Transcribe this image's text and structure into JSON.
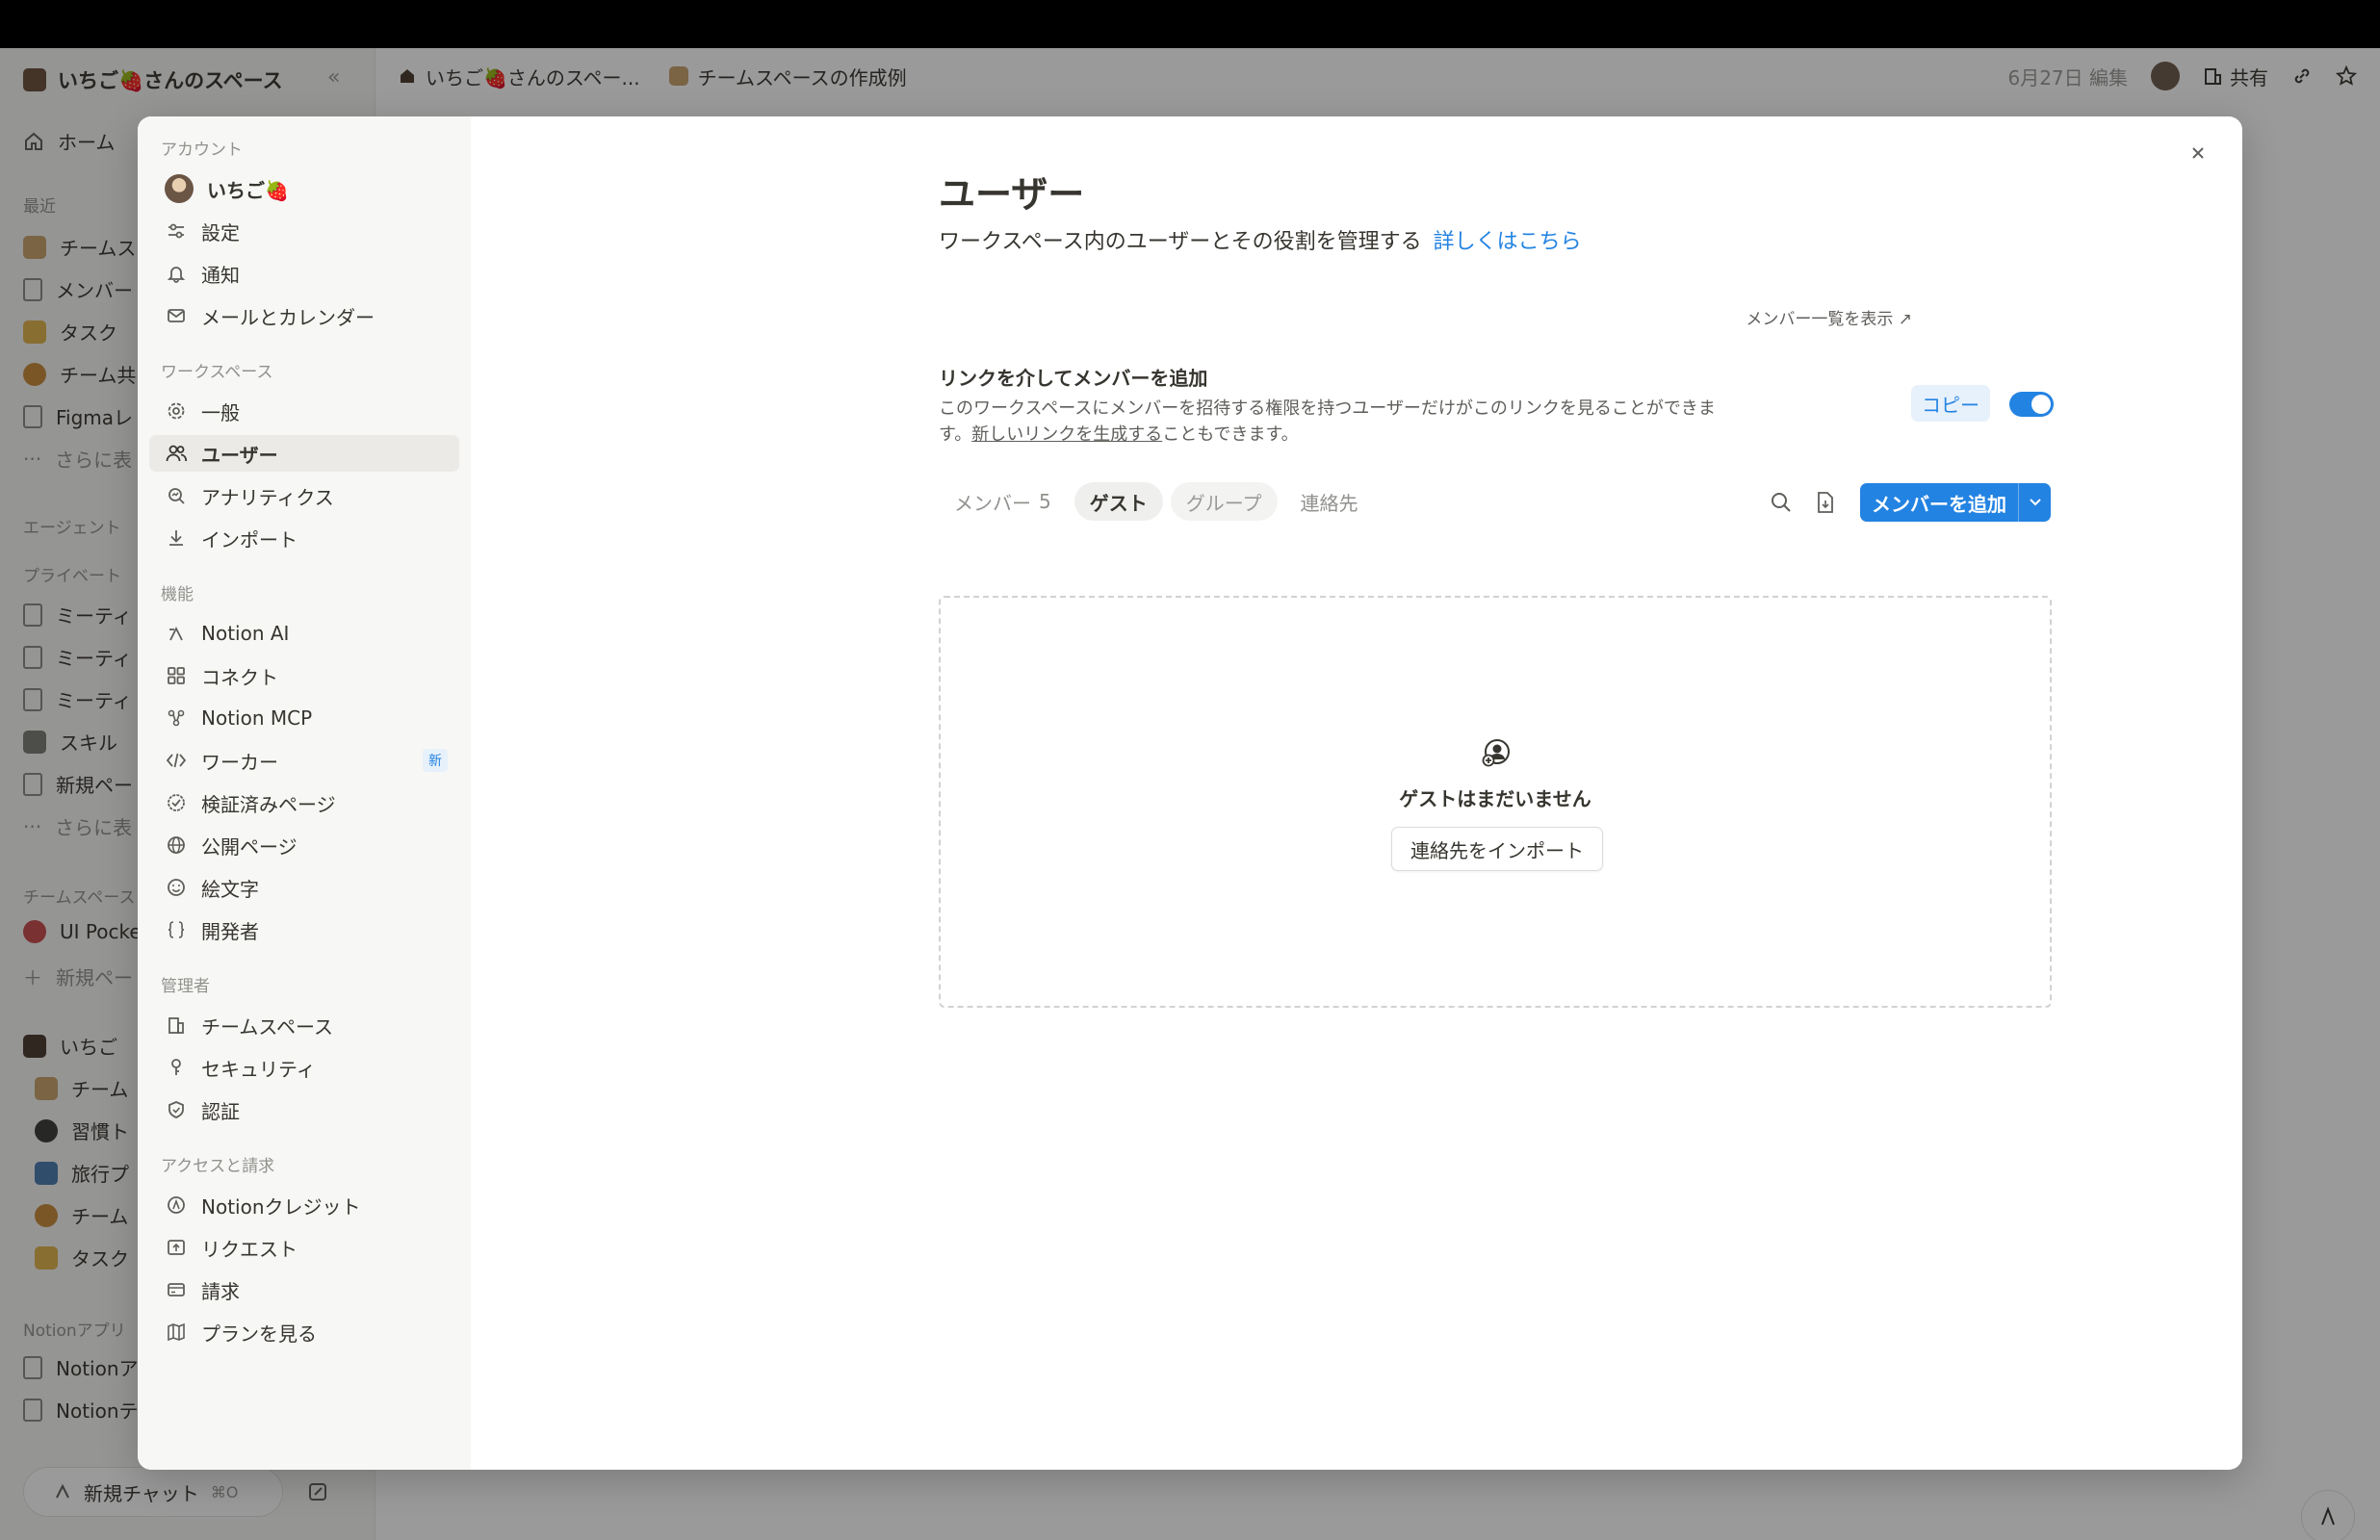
{
  "app": {
    "workspace_name": "いちご🍓さんのスペース",
    "breadcrumbs": [
      "いちご🍓さんのスペー...",
      "チームスペースの作成例"
    ],
    "edited": "6月27日 編集",
    "share_label": "共有",
    "collapse_glyph": "«"
  },
  "bg_sidebar": {
    "items": [
      {
        "label": "ホーム"
      },
      {
        "label": "チームス"
      },
      {
        "label": "メンバー"
      },
      {
        "label": "タスク"
      },
      {
        "label": "チーム共"
      },
      {
        "label": "Figmaレ"
      },
      {
        "label": "さらに表"
      },
      {
        "label": "ミーティ"
      },
      {
        "label": "ミーティ"
      },
      {
        "label": "ミーティ"
      },
      {
        "label": "スキル"
      },
      {
        "label": "新規ペー"
      },
      {
        "label": "さらに表"
      },
      {
        "label": "UI Pocke"
      },
      {
        "label": "新規ペー"
      },
      {
        "label": "いちご"
      },
      {
        "label": "チーム"
      },
      {
        "label": "習慣ト"
      },
      {
        "label": "旅行プ"
      },
      {
        "label": "チーム"
      },
      {
        "label": "タスク"
      },
      {
        "label": "Notionア"
      },
      {
        "label": "Notionテ"
      }
    ],
    "sections": [
      "最近",
      "エージェント",
      "プライベート",
      "チームスペース",
      "Notionアプリ"
    ],
    "new_chat": "新規チャット",
    "new_chat_kbd": "⌘O"
  },
  "settings_nav": {
    "account_section": "アカウント",
    "account_items": [
      "いちご🍓",
      "設定",
      "通知",
      "メールとカレンダー"
    ],
    "workspace_section": "ワークスペース",
    "workspace_items": [
      "一般",
      "ユーザー",
      "アナリティクス",
      "インポート"
    ],
    "features_section": "機能",
    "features_items": [
      "Notion AI",
      "コネクト",
      "Notion MCP",
      "ワーカー",
      "検証済みページ",
      "公開ページ",
      "絵文字",
      "開発者"
    ],
    "new_badge": "新",
    "admin_section": "管理者",
    "admin_items": [
      "チームスペース",
      "セキュリティ",
      "認証"
    ],
    "billing_section": "アクセスと請求",
    "billing_items": [
      "Notionクレジット",
      "リクエスト",
      "請求",
      "プランを見る"
    ]
  },
  "content": {
    "title": "ユーザー",
    "description": "ワークスペース内のユーザーとその役割を管理する",
    "learn_more": "詳しくはこちら",
    "member_list_link": "メンバー一覧を表示 ↗",
    "invite_title": "リンクを介してメンバーを追加",
    "invite_desc_1": "このワークスペースにメンバーを招待する権限を持つユーザーだけがこのリンクを見ることができます。",
    "invite_desc_link": "新しいリンクを生成する",
    "invite_desc_2": "こともできます。",
    "copy_label": "コピー",
    "tabs": [
      {
        "label": "メンバー",
        "count": "5"
      },
      {
        "label": "ゲスト"
      },
      {
        "label": "グループ"
      },
      {
        "label": "連絡先"
      }
    ],
    "add_member_label": "メンバーを追加",
    "empty_text": "ゲストはまだいません",
    "import_contacts": "連絡先をインポート"
  },
  "colors": {
    "accent": "#2383e2",
    "accent_soft": "#e7f1fb",
    "text": "#37352f",
    "muted": "#91918e"
  }
}
